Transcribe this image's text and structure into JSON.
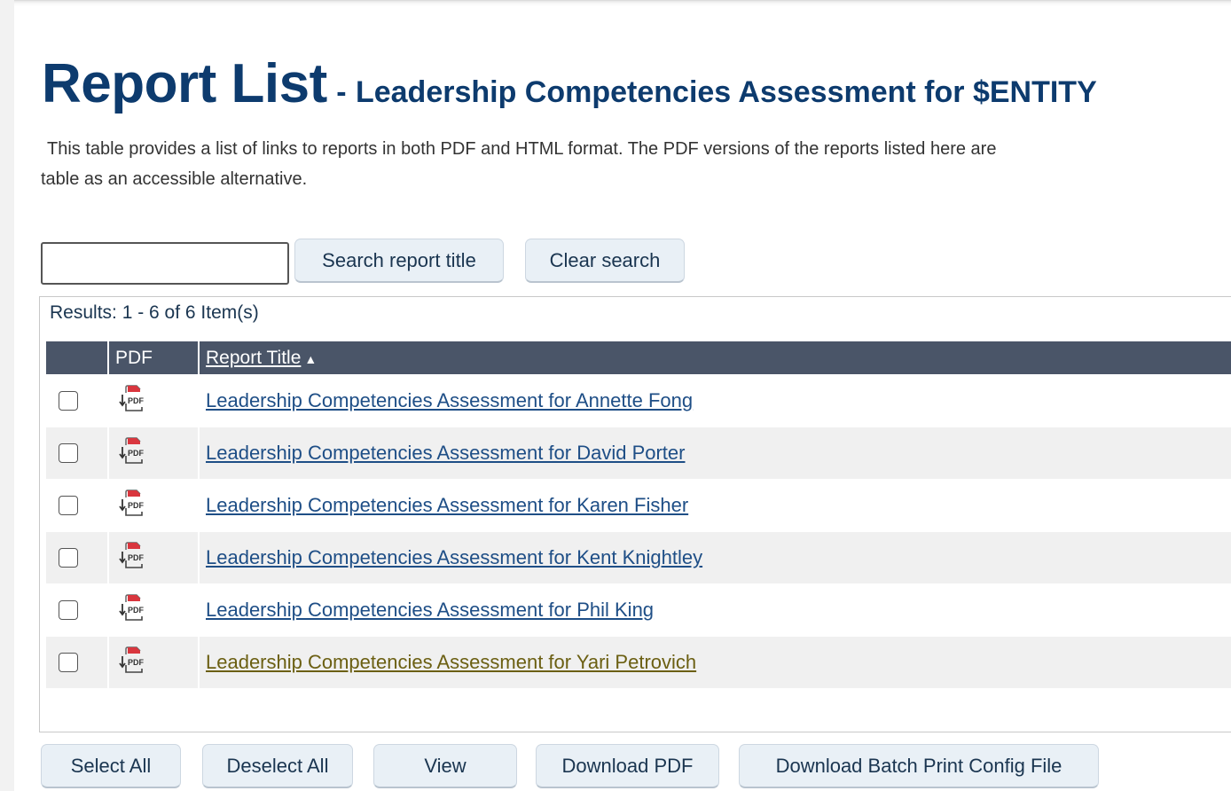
{
  "page": {
    "title": "Report List",
    "title_separator": "-",
    "subtitle": "Leadership Competencies Assessment for $ENTITY",
    "description_line1": "This table provides a list of links to reports in both PDF and HTML format. The PDF versions of the reports listed here are",
    "description_line2": "table as an accessible alternative."
  },
  "search": {
    "value": "",
    "placeholder": "",
    "search_button": "Search report title",
    "clear_button": "Clear search"
  },
  "results": {
    "count_text": "Results: 1 - 6 of 6 Item(s)",
    "columns": {
      "checkbox": "",
      "pdf": "PDF",
      "title": "Report Title",
      "sort_indicator": "▲"
    },
    "rows": [
      {
        "checked": false,
        "pdf_icon": "pdf-download-icon",
        "title": "Leadership Competencies Assessment for Annette Fong",
        "visited": false
      },
      {
        "checked": false,
        "pdf_icon": "pdf-download-icon",
        "title": "Leadership Competencies Assessment for David Porter",
        "visited": false
      },
      {
        "checked": false,
        "pdf_icon": "pdf-download-icon",
        "title": "Leadership Competencies Assessment for Karen Fisher",
        "visited": false
      },
      {
        "checked": false,
        "pdf_icon": "pdf-download-icon",
        "title": "Leadership Competencies Assessment for Kent Knightley",
        "visited": false
      },
      {
        "checked": false,
        "pdf_icon": "pdf-download-icon",
        "title": "Leadership Competencies Assessment for Phil King",
        "visited": false
      },
      {
        "checked": false,
        "pdf_icon": "pdf-download-icon",
        "title": "Leadership Competencies Assessment for Yari Petrovich",
        "visited": true
      }
    ]
  },
  "actions": {
    "select_all": "Select All",
    "deselect_all": "Deselect All",
    "view": "View",
    "download_pdf": "Download PDF",
    "download_batch": "Download Batch Print Config File"
  },
  "colors": {
    "title": "#0d3b6e",
    "link": "#1e4e86",
    "visited_link": "#6b5f12",
    "header_bg": "#4a5568",
    "button_bg": "#e9f0f6"
  }
}
